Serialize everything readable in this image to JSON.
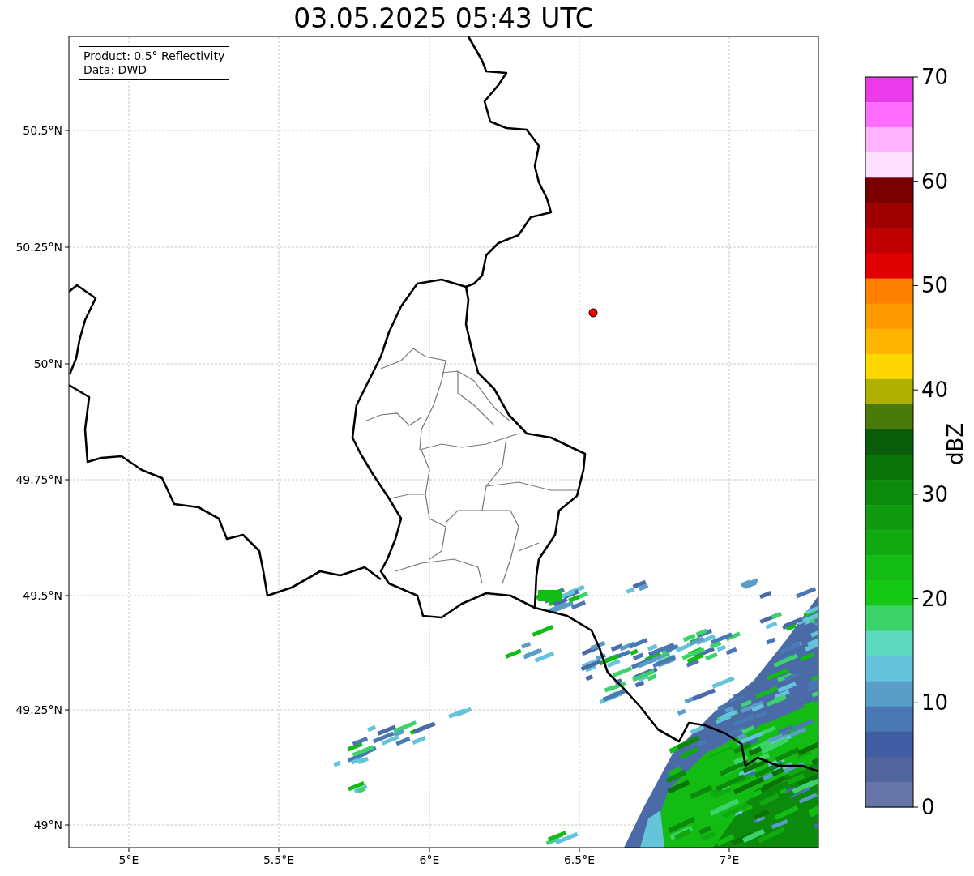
{
  "title": "03.05.2025 05:43 UTC",
  "info_box": {
    "lines": [
      "Product: 0.5° Reflectivity",
      "Data: DWD"
    ]
  },
  "map": {
    "latitude_labels": [
      "50.5°N",
      "50.25°N",
      "50°N",
      "49.75°N",
      "49.5°N",
      "49.25°N",
      "49°N"
    ],
    "longitude_labels": [
      "5°E",
      "5.5°E",
      "6°E",
      "6.5°E",
      "7°E"
    ]
  },
  "colorbar": {
    "label": "dBZ",
    "tick_labels": [
      "70",
      "60",
      "50",
      "40",
      "30",
      "20",
      "10",
      "0"
    ],
    "segments": [
      {
        "color": "#ea3aea"
      },
      {
        "color": "#ff6eff"
      },
      {
        "color": "#ffb3ff"
      },
      {
        "color": "#ffe0ff"
      },
      {
        "color": "#7a0000"
      },
      {
        "color": "#a00000"
      },
      {
        "color": "#c00000"
      },
      {
        "color": "#e00000"
      },
      {
        "color": "#ff7f00"
      },
      {
        "color": "#ff9900"
      },
      {
        "color": "#ffb400"
      },
      {
        "color": "#ffd700"
      },
      {
        "color": "#b0b000"
      },
      {
        "color": "#4a7a0a"
      },
      {
        "color": "#0a5e0a"
      },
      {
        "color": "#0a740a"
      },
      {
        "color": "#0c8a0c"
      },
      {
        "color": "#0f9a0f"
      },
      {
        "color": "#10aa10"
      },
      {
        "color": "#12bc12"
      },
      {
        "color": "#14c814"
      },
      {
        "color": "#3cd46a"
      },
      {
        "color": "#5fd8c0"
      },
      {
        "color": "#65c3dc"
      },
      {
        "color": "#5a9ec8"
      },
      {
        "color": "#4a78b4"
      },
      {
        "color": "#425ea2"
      },
      {
        "color": "#52649c"
      },
      {
        "color": "#6674a8"
      }
    ]
  }
}
